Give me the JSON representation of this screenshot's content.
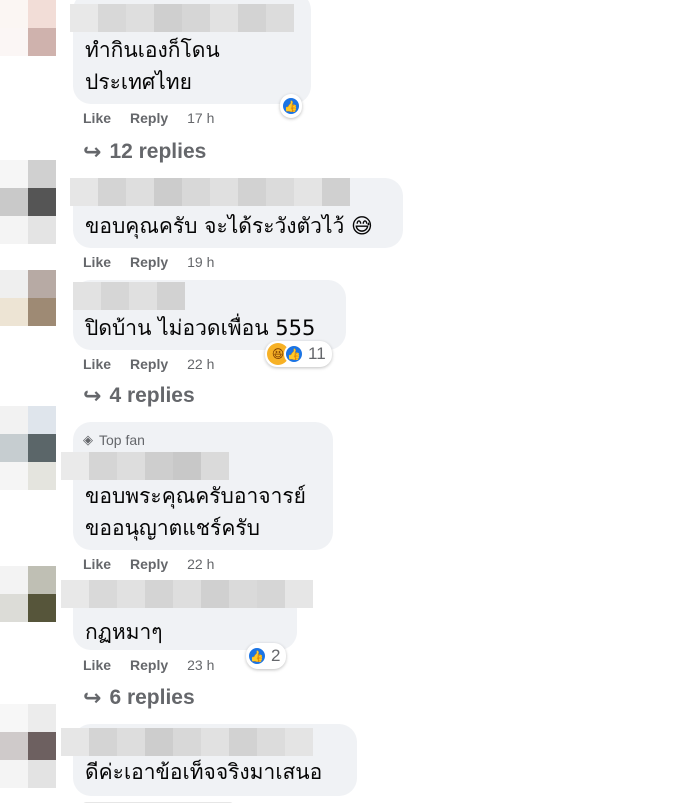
{
  "comments": [
    {
      "text": "ทำกินเองก็โดน\nประเทศไทย",
      "time": "17 h",
      "replies": "12 replies",
      "reaction_count": ""
    },
    {
      "text": "ขอบคุณครับ จะได้ระวังตัวไว้ 😅",
      "time": "19 h",
      "replies": "",
      "reaction_count": ""
    },
    {
      "text": "ปิดบ้าน ไม่อวดเพื่อน 555",
      "time": "22 h",
      "replies": "4 replies",
      "reaction_count": "11"
    },
    {
      "badge": "Top fan",
      "text": "ขอบพระคุณครับอาจารย์\nขออนุญาตแชร์ครับ",
      "time": "22 h",
      "replies": "",
      "reaction_count": ""
    },
    {
      "text": "กฏหมาๆ",
      "time": "23 h",
      "replies": "6 replies",
      "reaction_count": "2"
    },
    {
      "text": "ดีค่ะเอาข้อเท็จจริงมาเสนอ",
      "time": "",
      "replies": "",
      "reaction_count": ""
    }
  ],
  "actions": {
    "like": "Like",
    "reply": "Reply"
  },
  "icons": {
    "reply_arrow": "reply-arrow-icon",
    "like": "like-icon",
    "haha": "haha-icon",
    "top_fan": "diamond-icon"
  },
  "colors": {
    "bubble": "#f0f2f5",
    "meta": "#65676b",
    "like_blue": "#1b74e4"
  }
}
